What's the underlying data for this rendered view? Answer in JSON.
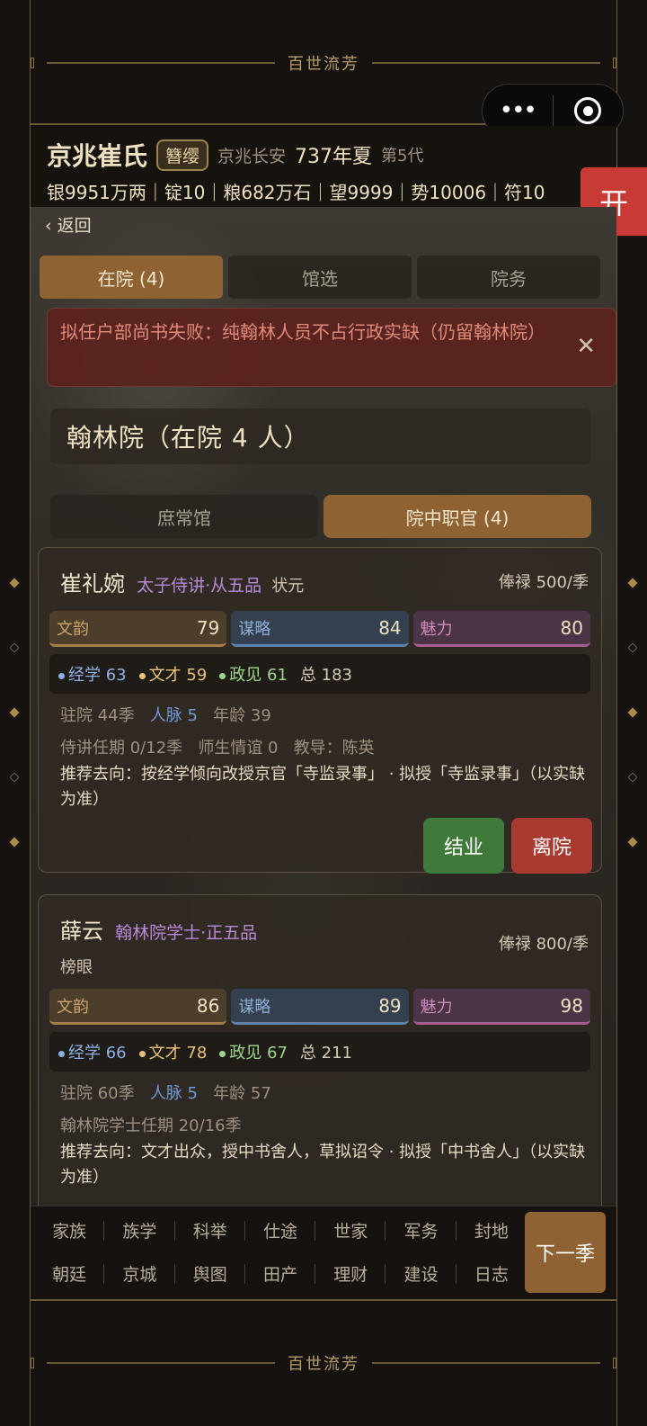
{
  "app": {
    "banner_title": "百世流芳"
  },
  "header": {
    "clan": "京兆崔氏",
    "badge": "簪缨",
    "location": "京兆长安",
    "year": "737年夏",
    "generation": "第5代",
    "resources": "银9951万两｜锭10｜粮682万石｜望9999｜势10006｜符10"
  },
  "open_button": "开",
  "back_label": "返回",
  "tabs": [
    {
      "label": "在院 (4)",
      "active": true
    },
    {
      "label": "馆选",
      "active": false
    },
    {
      "label": "院务",
      "active": false
    }
  ],
  "alert": {
    "text": "拟任户部尚书失败：纯翰林人员不占行政实缺（仍留翰林院）",
    "close": "✕"
  },
  "section_title": "翰林院（在院 4 人）",
  "subtabs": [
    {
      "label": "庶常馆",
      "active": false
    },
    {
      "label": "院中职官 (4)",
      "active": true
    }
  ],
  "cards": [
    {
      "name": "崔礼婉",
      "title": "太子侍讲·从五品",
      "honor": "状元",
      "pay": "俸禄 500/季",
      "stats": [
        {
          "label": "文韵",
          "value": "79"
        },
        {
          "label": "谋略",
          "value": "84"
        },
        {
          "label": "魅力",
          "value": "80"
        }
      ],
      "subskills": {
        "a_label": "经学",
        "a": "63",
        "b_label": "文才",
        "b": "59",
        "c_label": "政见",
        "c": "61",
        "total_label": "总",
        "total": "183"
      },
      "stay": "驻院 44季",
      "network": "人脉 5",
      "age": "年龄 39",
      "term": "侍讲任期 0/12季",
      "mentor_bond": "师生情谊 0",
      "teacher": "教导：陈英",
      "recommend": "推荐去向：按经学倾向改授京官「寺监录事」 · 拟授「寺监录事」（以实缺为准）",
      "btn_graduate": "结业",
      "btn_leave": "离院"
    },
    {
      "name": "薛云",
      "title": "翰林院学士·正五品",
      "honor": "榜眼",
      "pay": "俸禄 800/季",
      "stats": [
        {
          "label": "文韵",
          "value": "86"
        },
        {
          "label": "谋略",
          "value": "89"
        },
        {
          "label": "魅力",
          "value": "98"
        }
      ],
      "subskills": {
        "a_label": "经学",
        "a": "66",
        "b_label": "文才",
        "b": "78",
        "c_label": "政见",
        "c": "67",
        "total_label": "总",
        "total": "211"
      },
      "stay": "驻院 60季",
      "network": "人脉 5",
      "age": "年龄 57",
      "term": "翰林院学士任期 20/16季",
      "recommend": "推荐去向：文才出众，授中书舍人，草拟诏令 · 拟授「中书舍人」（以实缺为准）"
    }
  ],
  "bottom_nav": [
    "家族",
    "族学",
    "科举",
    "仕途",
    "世家",
    "军务",
    "封地",
    "朝廷",
    "京城",
    "舆图",
    "田产",
    "理财",
    "建设",
    "日志"
  ],
  "next_season": "下一季",
  "colors": {
    "accent": "#8e6232",
    "alert_bg": "#5c221e",
    "green": "#3f7a3a",
    "red": "#a83a30"
  }
}
